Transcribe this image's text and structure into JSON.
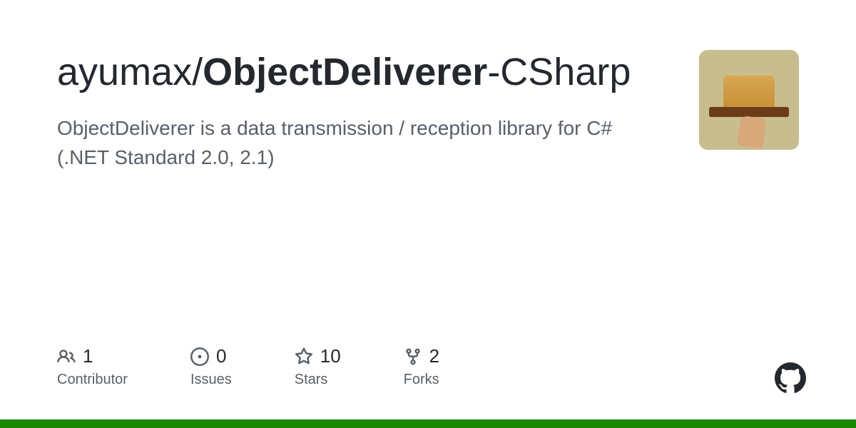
{
  "repo": {
    "owner": "ayumax",
    "slash": "/",
    "name_strong": "ObjectDeliverer",
    "name_rest": "-CSharp",
    "description": "ObjectDeliverer is a data transmission / reception library for C#(.NET Standard 2.0, 2.1)"
  },
  "stats": {
    "contributors": {
      "value": "1",
      "label": "Contributor"
    },
    "issues": {
      "value": "0",
      "label": "Issues"
    },
    "stars": {
      "value": "10",
      "label": "Stars"
    },
    "forks": {
      "value": "2",
      "label": "Forks"
    }
  },
  "language_bar": [
    {
      "color": "#178600",
      "width": "100%"
    }
  ]
}
